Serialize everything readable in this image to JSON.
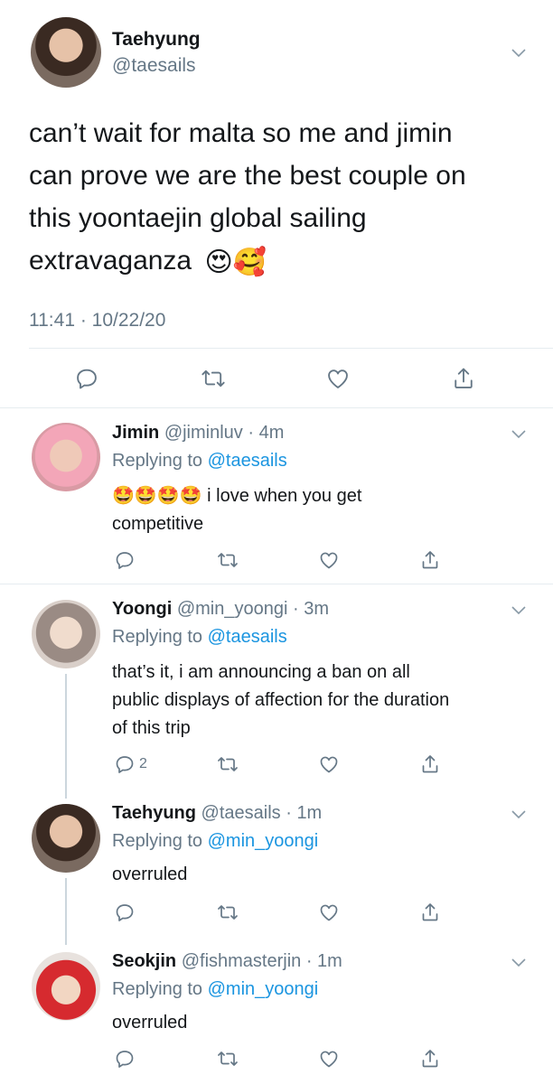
{
  "main_tweet": {
    "display_name": "Taehyung",
    "handle": "@taesails",
    "text_lines": [
      "can’t wait for malta so me and jimin",
      "can prove we are the best couple on",
      "this yoontaejin global sailing",
      "extravaganza"
    ],
    "emojis": [
      "😍",
      "🥰"
    ],
    "timestamp": "11:41 · 10/22/20"
  },
  "replies": [
    {
      "display_name": "Jimin",
      "handle": "@jiminluv",
      "time": "4m",
      "replying_label": "Replying to",
      "replying_to": "@taesails",
      "emoji_prefix": "🤩🤩🤩🤩",
      "text_line1": " i love when you get",
      "text_line2": "competitive",
      "reply_count": ""
    },
    {
      "display_name": "Yoongi",
      "handle": "@min_yoongi",
      "time": "3m",
      "replying_label": "Replying to",
      "replying_to": "@taesails",
      "text_line1": "that’s it, i am announcing a ban on all",
      "text_line2": "public displays of affection for the duration",
      "text_line3": "of this trip",
      "reply_count": "2"
    },
    {
      "display_name": "Taehyung",
      "handle": "@taesails",
      "time": "1m",
      "replying_label": "Replying to",
      "replying_to": "@min_yoongi",
      "text_line1": "overruled",
      "reply_count": ""
    },
    {
      "display_name": "Seokjin",
      "handle": "@fishmasterjin",
      "time": "1m",
      "replying_label": "Replying to",
      "replying_to": "@min_yoongi",
      "text_line1": "overruled",
      "reply_count": ""
    }
  ],
  "separator": " · ",
  "colors": {
    "link": "#1b95e0",
    "secondary_text": "#657786",
    "icon": "#657786",
    "divider": "#e6ecf0"
  },
  "icons": [
    "chevron-down-icon",
    "reply-icon",
    "retweet-icon",
    "like-icon",
    "share-icon"
  ]
}
